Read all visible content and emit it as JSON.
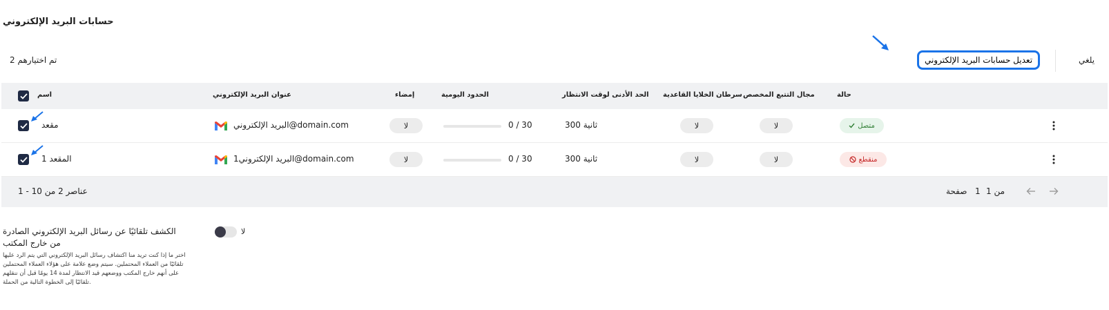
{
  "page": {
    "title": "حسابات البريد الإلكتروني"
  },
  "toolbar": {
    "selected_count": "تم اختيارهم 2",
    "edit_label": "تعديل حسابات البريد الإلكتروني",
    "cancel_label": "يلغي"
  },
  "table": {
    "headers": {
      "name": "اسم",
      "email": "عنوان البريد الإلكتروني",
      "signature": "إمضاء",
      "daily_limits": "الحدود اليومية",
      "min_wait": "الحد الأدنى لوقت الانتظار",
      "bcc": "سرطان الخلايا القاعدية",
      "custom_tracking": "مجال التتبع المخصص",
      "status": "حالة"
    },
    "rows": [
      {
        "name": "مقعد",
        "email": "البريد الإلكتروني@domain.com",
        "signature": "لا",
        "daily_limit_text": "0 / 30",
        "daily_limit_fraction": 0,
        "wait": "300 ثانية",
        "bcc": "لا",
        "tracking": "لا",
        "status": "متصل",
        "status_icon": "check-icon",
        "checked": true
      },
      {
        "name": "المقعد 1",
        "email": "البريد الإلكتروني1@domain.com",
        "signature": "لا",
        "daily_limit_text": "0 / 30",
        "daily_limit_fraction": 0,
        "wait": "300 ثانية",
        "bcc": "لا",
        "tracking": "لا",
        "status": "منقطع",
        "status_icon": "blocked-icon",
        "checked": true
      }
    ],
    "footer": {
      "range": "1 - 10 عناصر 2 من",
      "page_number": "1",
      "page_word": "صفحة",
      "page_of": "من 1"
    }
  },
  "ooo": {
    "toggle_label": "لا",
    "toggle_on": false,
    "title": "الكشف تلقائيًا عن رسائل البريد الإلكتروني الصادرة من خارج المكتب",
    "description": "اختر ما إذا كنت تريد منا اكتشاف رسائل البريد الإلكتروني التي يتم الرد عليها تلقائيًا من العملاء المحتملين. سيتم وضع علامة على هؤلاء العملاء المحتملين على أنهم خارج المكتب ووضعهم قيد الانتظار لمدة 14 يومًا قبل أن ننقلهم تلقائيًا إلى الخطوة التالية من الحملة."
  },
  "colors": {
    "accent": "#1a73e8",
    "header_bg": "#f0f1f3",
    "checkbox": "#1f2a44",
    "connected_bg": "#e6f4ea",
    "connected_text": "#2e7d32",
    "disconnected_bg": "#fce8e6",
    "disconnected_text": "#c62828"
  }
}
